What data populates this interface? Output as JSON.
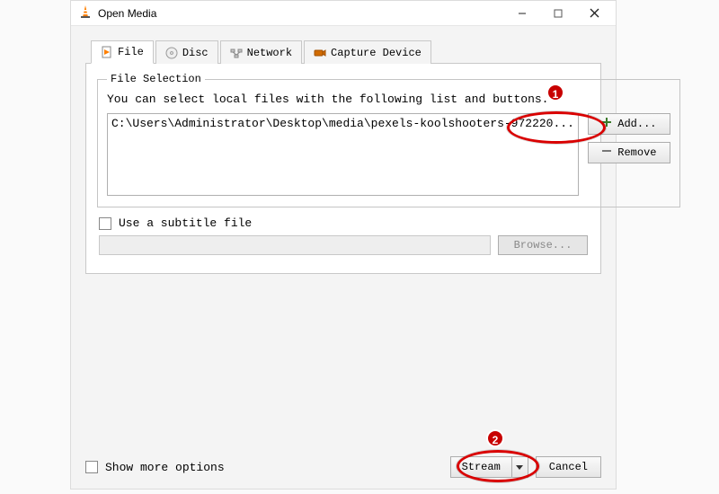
{
  "window": {
    "title": "Open Media",
    "btn_min": "minimize",
    "btn_max": "maximize",
    "btn_close": "close"
  },
  "tabs": {
    "file": "File",
    "disc": "Disc",
    "network": "Network",
    "capture": "Capture Device",
    "active": "file"
  },
  "file_section": {
    "legend": "File Selection",
    "help": "You can select local files with the following list and buttons.",
    "files": [
      "C:\\Users\\Administrator\\Desktop\\media\\pexels-koolshooters-972220..."
    ],
    "add_label": "Add...",
    "remove_label": "Remove"
  },
  "subtitle": {
    "checkbox_label": "Use a subtitle file",
    "checked": false,
    "browse_label": "Browse..."
  },
  "footer": {
    "show_more_label": "Show more options",
    "show_more_checked": false,
    "play_label": "Stream",
    "cancel_label": "Cancel"
  },
  "annotations": {
    "1": "1",
    "2": "2"
  }
}
